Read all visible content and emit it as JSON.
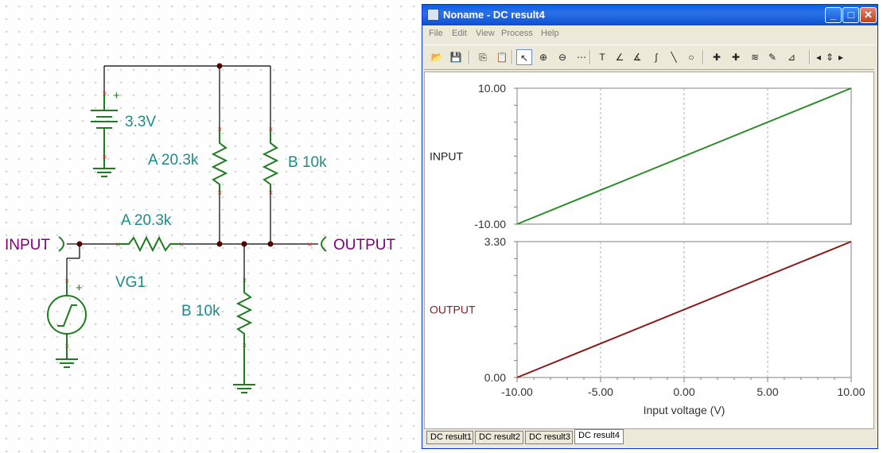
{
  "schematic": {
    "battery_label": "3.3V",
    "battery_plus": "+",
    "r_top_a_label": "A 20.3k",
    "r_top_b_label": "B 10k",
    "r_series_label": "A 20.3k",
    "r_bottom_label": "B 10k",
    "source_label": "VG1",
    "source_plus": "+",
    "input_port": "INPUT",
    "output_port": "OUTPUT",
    "colors": {
      "component": "#1e7d1e",
      "wire": "#000000",
      "label": "#1f8a8a",
      "port": "#800080",
      "node": "#4d0000"
    }
  },
  "window": {
    "title": "Noname - DC result4",
    "controls": {
      "minimize": "_",
      "maximize": "□",
      "close": "✕"
    },
    "menu": [
      "File",
      "Edit",
      "View",
      "Process",
      "Help"
    ],
    "toolbar": [
      {
        "name": "open-folder-icon",
        "glyph": "📂"
      },
      {
        "name": "save-icon",
        "glyph": "💾"
      },
      {
        "name": "copy-icon",
        "glyph": "⎘"
      },
      {
        "name": "paste-icon",
        "glyph": "📋"
      },
      {
        "name": "pointer-icon",
        "glyph": "↖"
      },
      {
        "name": "zoom-in-icon",
        "glyph": "⊕"
      },
      {
        "name": "zoom-100-icon",
        "glyph": "⊖"
      },
      {
        "name": "grid-icon",
        "glyph": "⋯"
      },
      {
        "name": "text-icon",
        "glyph": "T"
      },
      {
        "name": "curve-label-icon",
        "glyph": "∠"
      },
      {
        "name": "curve-label-2-icon",
        "glyph": "∡"
      },
      {
        "name": "formula-icon",
        "glyph": "∫"
      },
      {
        "name": "line-icon",
        "glyph": "╲"
      },
      {
        "name": "circle-icon",
        "glyph": "○"
      },
      {
        "name": "cursor-a-icon",
        "glyph": "✚"
      },
      {
        "name": "cursor-b-icon",
        "glyph": "✚"
      },
      {
        "name": "waves-icon",
        "glyph": "≋"
      },
      {
        "name": "probe-icon",
        "glyph": "✎"
      },
      {
        "name": "slope-icon",
        "glyph": "⊿"
      },
      {
        "name": "arrow-left-icon",
        "glyph": "◂"
      },
      {
        "name": "arrow-updown-icon",
        "glyph": "⇕"
      },
      {
        "name": "arrow-right-icon",
        "glyph": "▸"
      }
    ],
    "tabs": [
      "DC result1",
      "DC result2",
      "DC result3",
      "DC result4"
    ],
    "active_tab": 3
  },
  "chart_data": [
    {
      "type": "line",
      "ylabel": "INPUT",
      "y_ticks": [
        "10.00",
        "-10.00"
      ],
      "ylim": [
        -10,
        10
      ],
      "xlim": [
        -10,
        10
      ],
      "grid": "vertical-dashed",
      "color": "#2e8b2e",
      "series": [
        {
          "name": "INPUT",
          "x": [
            -10,
            10
          ],
          "y": [
            -10,
            10
          ]
        }
      ]
    },
    {
      "type": "line",
      "ylabel": "OUTPUT",
      "y_ticks": [
        "3.30",
        "0.00"
      ],
      "ylim": [
        0,
        3.3
      ],
      "xlim": [
        -10,
        10
      ],
      "xlabel": "Input voltage (V)",
      "x_ticks": [
        "-10.00",
        "-5.00",
        "0.00",
        "5.00",
        "10.00"
      ],
      "grid": "vertical-dashed",
      "color": "#8b1a1a",
      "series": [
        {
          "name": "OUTPUT",
          "x": [
            -10,
            10
          ],
          "y": [
            0,
            3.3
          ]
        }
      ]
    }
  ]
}
